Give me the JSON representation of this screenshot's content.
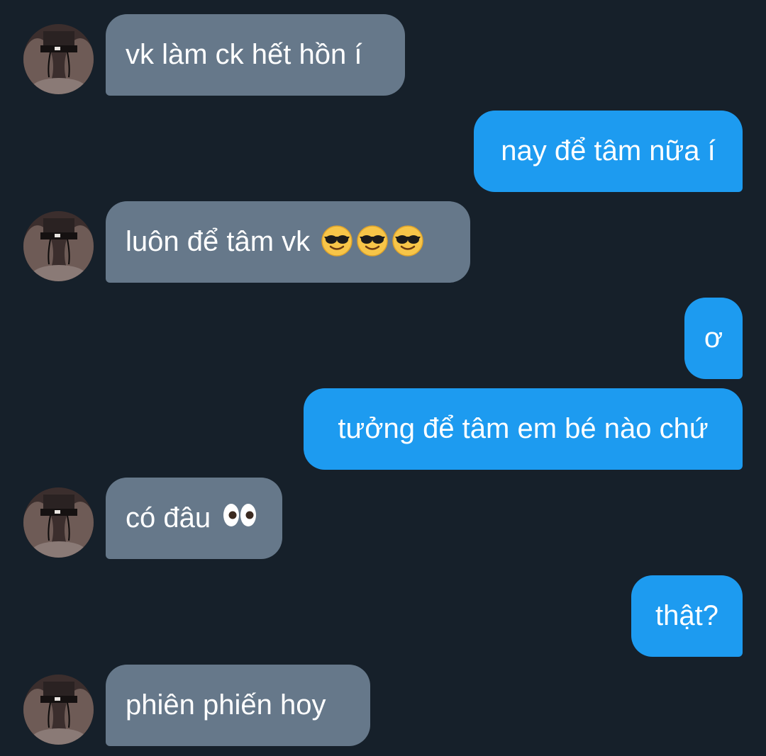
{
  "conversation": {
    "messages": [
      {
        "side": "in",
        "text": "vk làm ck hết hồn í",
        "emojis": []
      },
      {
        "side": "out",
        "text": "nay để tâm nữa í",
        "emojis": []
      },
      {
        "side": "in",
        "text": "luôn để tâm vk",
        "emojis": [
          "smiling-face-with-sunglasses",
          "smiling-face-with-sunglasses",
          "smiling-face-with-sunglasses"
        ]
      },
      {
        "side": "out",
        "text": "ơ",
        "emojis": []
      },
      {
        "side": "out",
        "text": "tưởng để tâm em bé nào chứ",
        "emojis": []
      },
      {
        "side": "in",
        "text": "có đâu",
        "emojis": [
          "eyes"
        ]
      },
      {
        "side": "out",
        "text": "thật?",
        "emojis": []
      },
      {
        "side": "in",
        "text": "phiên phiến hoy",
        "emojis": []
      }
    ]
  },
  "colors": {
    "background": "#16202a",
    "incoming_bubble": "#66788a",
    "outgoing_bubble": "#1d9bf0",
    "text": "#ffffff"
  }
}
